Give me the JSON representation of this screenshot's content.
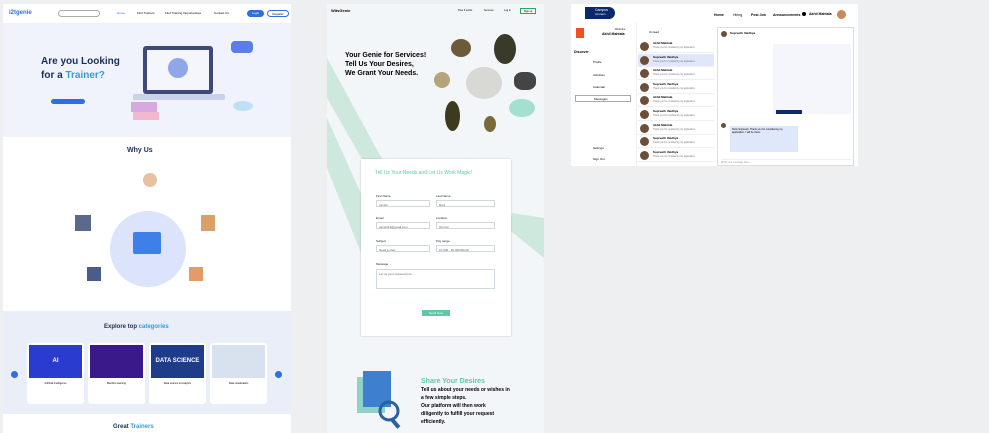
{
  "p1": {
    "logo": "i2tgenie",
    "nav": [
      "Home",
      "Find Trainers",
      "Find Training Opportunities",
      "Contact Us"
    ],
    "login": "Login",
    "register": "Register",
    "hero_l1": "Are you Looking",
    "hero_l2a": "for a ",
    "hero_l2b": "Trainer?",
    "why": "Why Us",
    "explore_a": "Explore top ",
    "explore_b": "categories",
    "cards": [
      {
        "label": "Artificial Intelligence",
        "img": "AI"
      },
      {
        "label": "Machine learning",
        "img": ""
      },
      {
        "label": "Data science & Analytics",
        "img": "DATA SCIENCE"
      },
      {
        "label": "Data visualization",
        "img": ""
      }
    ],
    "great_a": "Great ",
    "great_b": "Trainers"
  },
  "p2": {
    "logo": "WitsGenie",
    "nav": [
      "How It works",
      "Services",
      "Log in",
      "Sign up"
    ],
    "h1": "Your Genie for Services!",
    "h2": "Tell Us Your Desires,",
    "h3": "We Grant Your Needs.",
    "form_title": "Tell Us Your Needs and Let Us Work Magic!",
    "first_label": "First Name",
    "first_val": "vanshi",
    "last_label": "Last Name",
    "last_val": "Dani",
    "email_label": "Email",
    "email_val": "vanshi23@gmail.com",
    "loc_label": "Location",
    "loc_val": "Ab.com",
    "subject_label": "Subject",
    "subject_val": "Need a chef",
    "pay_label": "Pay range",
    "pay_val": "10,000 - 20,000/Month",
    "msg_label": "Message",
    "msg_ph": "Let us your request here ...",
    "send": "Send Now",
    "share_title": "Share Your Desires",
    "share_body": [
      "Tell us about your needs or wishes in",
      "a few simple steps.",
      "Our platform will then work",
      "diligently to fulfill your request",
      "efficiently."
    ]
  },
  "p3": {
    "logo_a": "Campus",
    "logo_b": "connect",
    "nav": [
      "Home",
      "Hiring",
      "Post Job",
      "Announcements"
    ],
    "user": "Akhil Mahtala",
    "welcome": "Welcome",
    "welcome_name": "Akhil Mahtala",
    "discover": "Discover",
    "menu": [
      "Profile",
      "Activities",
      "Calendar",
      "Messages"
    ],
    "menu_bottom": [
      "Settings",
      "Sign Out"
    ],
    "filter": "Unread",
    "chats": [
      {
        "name": "Akhil Mahtala",
        "t": "Thank you for considering my application."
      },
      {
        "name": "Supreeth Vaidhya",
        "t": "Thank you for considering my application."
      },
      {
        "name": "Akhil Mahtala",
        "t": "Thank you for considering my application."
      },
      {
        "name": "Supreeth Vaidhya",
        "t": "Thank you for considering my application."
      },
      {
        "name": "Akhil Mahtala",
        "t": "Thank you for considering my application."
      },
      {
        "name": "Supreeth Vaidhya",
        "t": "Thank you for considering my application."
      },
      {
        "name": "Akhil Mahtala",
        "t": "Thank you for considering my application."
      },
      {
        "name": "Supreeth Vaidhya",
        "t": "Thank you for considering my application."
      },
      {
        "name": "Supreeth Vaidhya",
        "t": "Thank you for considering my application."
      }
    ],
    "chat_head": "Supreeth Vaidhya",
    "msg_in": "Hello Supreeth, Thank you for considering my application. I will be there.",
    "reply_ph": "Write your message here..."
  }
}
